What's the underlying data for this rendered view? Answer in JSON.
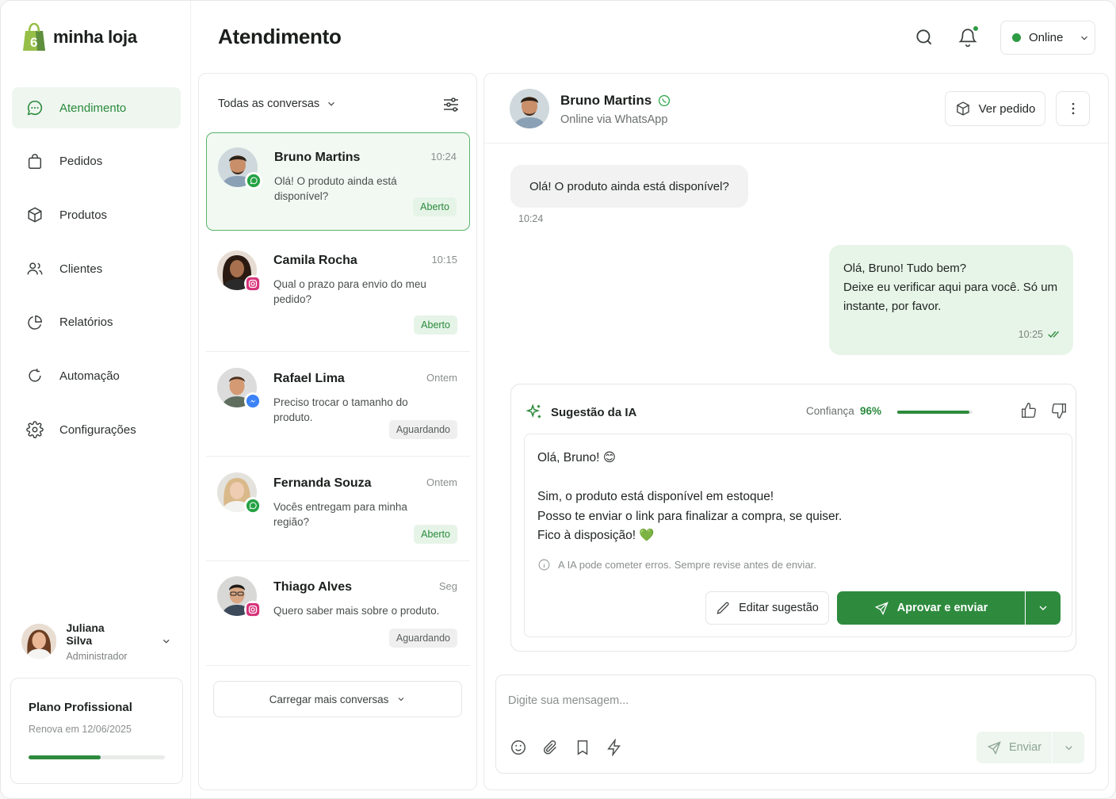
{
  "brand": {
    "name": "minha loja"
  },
  "sidebar": {
    "items": [
      {
        "label": "Atendimento",
        "icon": "chat-icon",
        "active": true
      },
      {
        "label": "Pedidos",
        "icon": "shopping-bag-icon"
      },
      {
        "label": "Produtos",
        "icon": "box-icon"
      },
      {
        "label": "Clientes",
        "icon": "users-icon"
      },
      {
        "label": "Relatórios",
        "icon": "pie-chart-icon"
      },
      {
        "label": "Automação",
        "icon": "refresh-icon"
      },
      {
        "label": "Configurações",
        "icon": "gear-icon"
      }
    ],
    "user": {
      "name": "Juliana Silva",
      "role": "Administrador"
    },
    "plan": {
      "title": "Plano Profissional",
      "renewal": "Renova em 12/06/2025",
      "progress": 0.53
    }
  },
  "header": {
    "title": "Atendimento",
    "status": "Online"
  },
  "conversations": {
    "filter_label": "Todas as conversas",
    "items": [
      {
        "name": "Bruno Martins",
        "time": "10:24",
        "message": "Olá! O produto ainda está disponível?",
        "status": "Aberto",
        "channel": "whatsapp"
      },
      {
        "name": "Camila Rocha",
        "time": "10:15",
        "message": "Qual o prazo para envio do meu pedido?",
        "status": "Aberto",
        "channel": "instagram"
      },
      {
        "name": "Rafael Lima",
        "time": "Ontem",
        "message": "Preciso trocar o tamanho do produto.",
        "status": "Aguardando",
        "channel": "messenger"
      },
      {
        "name": "Fernanda Souza",
        "time": "Ontem",
        "message": "Vocês entregam para minha região?",
        "status": "Aberto",
        "channel": "whatsapp"
      },
      {
        "name": "Thiago Alves",
        "time": "Seg",
        "message": "Quero saber mais sobre o produto.",
        "status": "Aguardando",
        "channel": "instagram"
      }
    ],
    "load_more": "Carregar mais conversas"
  },
  "chat": {
    "contact_name": "Bruno Martins",
    "contact_sub": "Online via WhatsApp",
    "order_button": "Ver pedido",
    "incoming": {
      "text": "Olá! O produto ainda está disponível?",
      "time": "10:24"
    },
    "outgoing": {
      "lines": [
        "Olá, Bruno! Tudo bem?",
        "Deixe eu verificar aqui para você. Só um",
        "instante, por favor."
      ],
      "time": "10:25"
    },
    "ai": {
      "title": "Sugestão da IA",
      "confidence_label": "Confiança",
      "confidence_value": "96%",
      "lines": [
        "Olá, Bruno! 😊",
        "",
        "Sim, o produto está disponível em estoque!",
        "Posso te enviar o link para finalizar a compra, se quiser.",
        "Fico à disposição! 💚"
      ],
      "note": "A IA pode cometer erros. Sempre revise antes de enviar.",
      "edit_label": "Editar sugestão",
      "approve_label": "Aprovar e enviar"
    },
    "composer": {
      "placeholder": "Digite sua mensagem...",
      "send_label": "Enviar"
    }
  },
  "colors": {
    "accent": "#2e8b3e",
    "accent_light": "#e7f5e8",
    "whatsapp": "#25a244",
    "instagram": "#d6337a",
    "messenger": "#3b82f6"
  }
}
